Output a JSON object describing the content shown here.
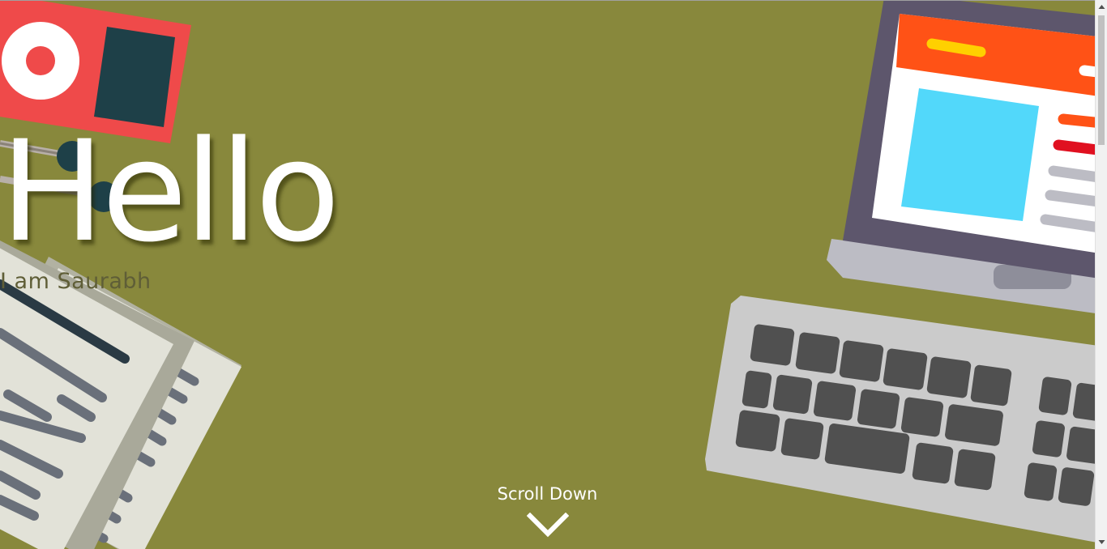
{
  "hero": {
    "title": "Hello",
    "subtitle": "I am Saurabh"
  },
  "scroll": {
    "label": "Scroll Down",
    "icon": "chevron-down-icon"
  },
  "colors": {
    "background": "#88883c",
    "title": "#ffffff",
    "subtitle": "#5f5e37"
  }
}
